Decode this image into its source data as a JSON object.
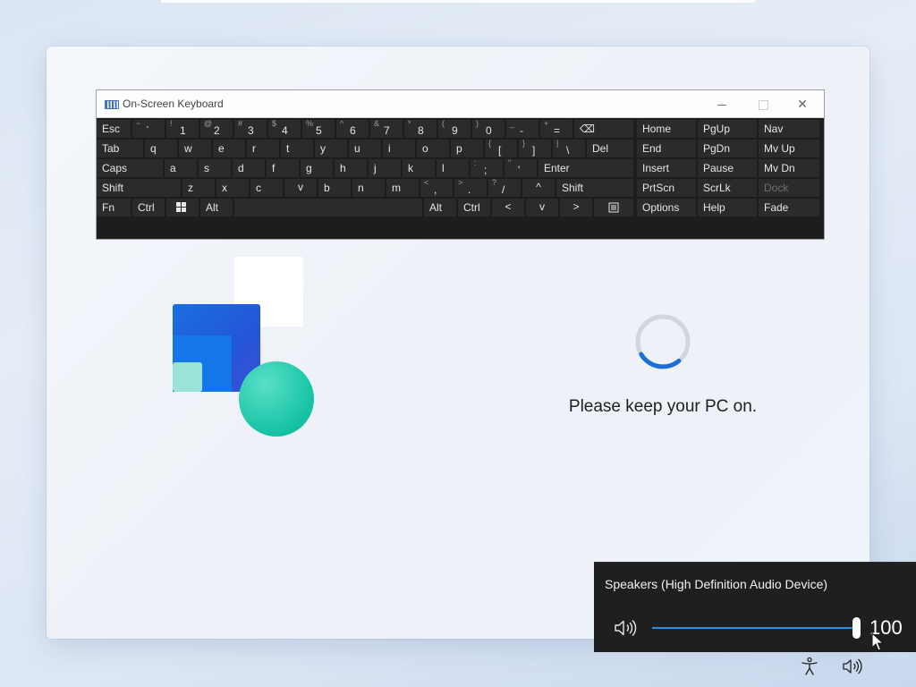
{
  "osk": {
    "title": "On-Screen Keyboard",
    "minimize_label": "—",
    "close_label": "✕",
    "row1": [
      {
        "lbl": "Esc"
      },
      {
        "shift": "~",
        "main": "`"
      },
      {
        "shift": "!",
        "main": "1"
      },
      {
        "shift": "@",
        "main": "2"
      },
      {
        "shift": "#",
        "main": "3"
      },
      {
        "shift": "$",
        "main": "4"
      },
      {
        "shift": "%",
        "main": "5"
      },
      {
        "shift": "^",
        "main": "6"
      },
      {
        "shift": "&",
        "main": "7"
      },
      {
        "shift": "*",
        "main": "8"
      },
      {
        "shift": "(",
        "main": "9"
      },
      {
        "shift": ")",
        "main": "0"
      },
      {
        "shift": "_",
        "main": "-"
      },
      {
        "shift": "+",
        "main": "="
      },
      {
        "lbl": "⌫"
      }
    ],
    "row2": [
      {
        "lbl": "Tab"
      },
      {
        "lbl": "q"
      },
      {
        "lbl": "w"
      },
      {
        "lbl": "e"
      },
      {
        "lbl": "r"
      },
      {
        "lbl": "t"
      },
      {
        "lbl": "y"
      },
      {
        "lbl": "u"
      },
      {
        "lbl": "i"
      },
      {
        "lbl": "o"
      },
      {
        "lbl": "p"
      },
      {
        "shift": "{",
        "main": "["
      },
      {
        "shift": "}",
        "main": "]"
      },
      {
        "shift": "|",
        "main": "\\"
      },
      {
        "lbl": "Del"
      }
    ],
    "row3": [
      {
        "lbl": "Caps"
      },
      {
        "lbl": "a"
      },
      {
        "lbl": "s"
      },
      {
        "lbl": "d"
      },
      {
        "lbl": "f"
      },
      {
        "lbl": "g"
      },
      {
        "lbl": "h"
      },
      {
        "lbl": "j"
      },
      {
        "lbl": "k"
      },
      {
        "lbl": "l"
      },
      {
        "shift": ":",
        "main": ";"
      },
      {
        "shift": "\"",
        "main": "'"
      },
      {
        "lbl": "Enter"
      }
    ],
    "row4": [
      {
        "lbl": "Shift"
      },
      {
        "lbl": "z"
      },
      {
        "lbl": "x"
      },
      {
        "lbl": "c"
      },
      {
        "lbl": "v"
      },
      {
        "lbl": "b"
      },
      {
        "lbl": "n"
      },
      {
        "lbl": "m"
      },
      {
        "shift": "<",
        "main": ","
      },
      {
        "shift": ">",
        "main": "."
      },
      {
        "shift": "?",
        "main": "/"
      },
      {
        "lbl": "^"
      },
      {
        "lbl": "Shift"
      }
    ],
    "row5": [
      {
        "lbl": "Fn"
      },
      {
        "lbl": "Ctrl"
      },
      {
        "lbl": "windows-icon"
      },
      {
        "lbl": "Alt"
      },
      {
        "lbl": ""
      },
      {
        "lbl": "Alt"
      },
      {
        "lbl": "Ctrl"
      },
      {
        "lbl": "<"
      },
      {
        "lbl": "v"
      },
      {
        "lbl": ">"
      },
      {
        "lbl": "menu-icon"
      }
    ],
    "nav_keys": [
      [
        "Home",
        "PgUp",
        "Nav"
      ],
      [
        "End",
        "PgDn",
        "Mv Up"
      ],
      [
        "Insert",
        "Pause",
        "Mv Dn"
      ],
      [
        "PrtScn",
        "ScrLk",
        "Dock"
      ],
      [
        "Options",
        "Help",
        "Fade"
      ]
    ]
  },
  "status_message": "Please keep your PC on.",
  "volume": {
    "device_name": "Speakers (High Definition Audio Device)",
    "level": 100,
    "level_label": "100"
  },
  "colors": {
    "accent": "#2d8fe0",
    "spinner": "#1a6fd8",
    "osk_bg": "#1d1d1d",
    "osk_key": "#2b2b2b"
  },
  "icons": {
    "taskbar": [
      "accessibility-icon",
      "volume-icon"
    ]
  }
}
